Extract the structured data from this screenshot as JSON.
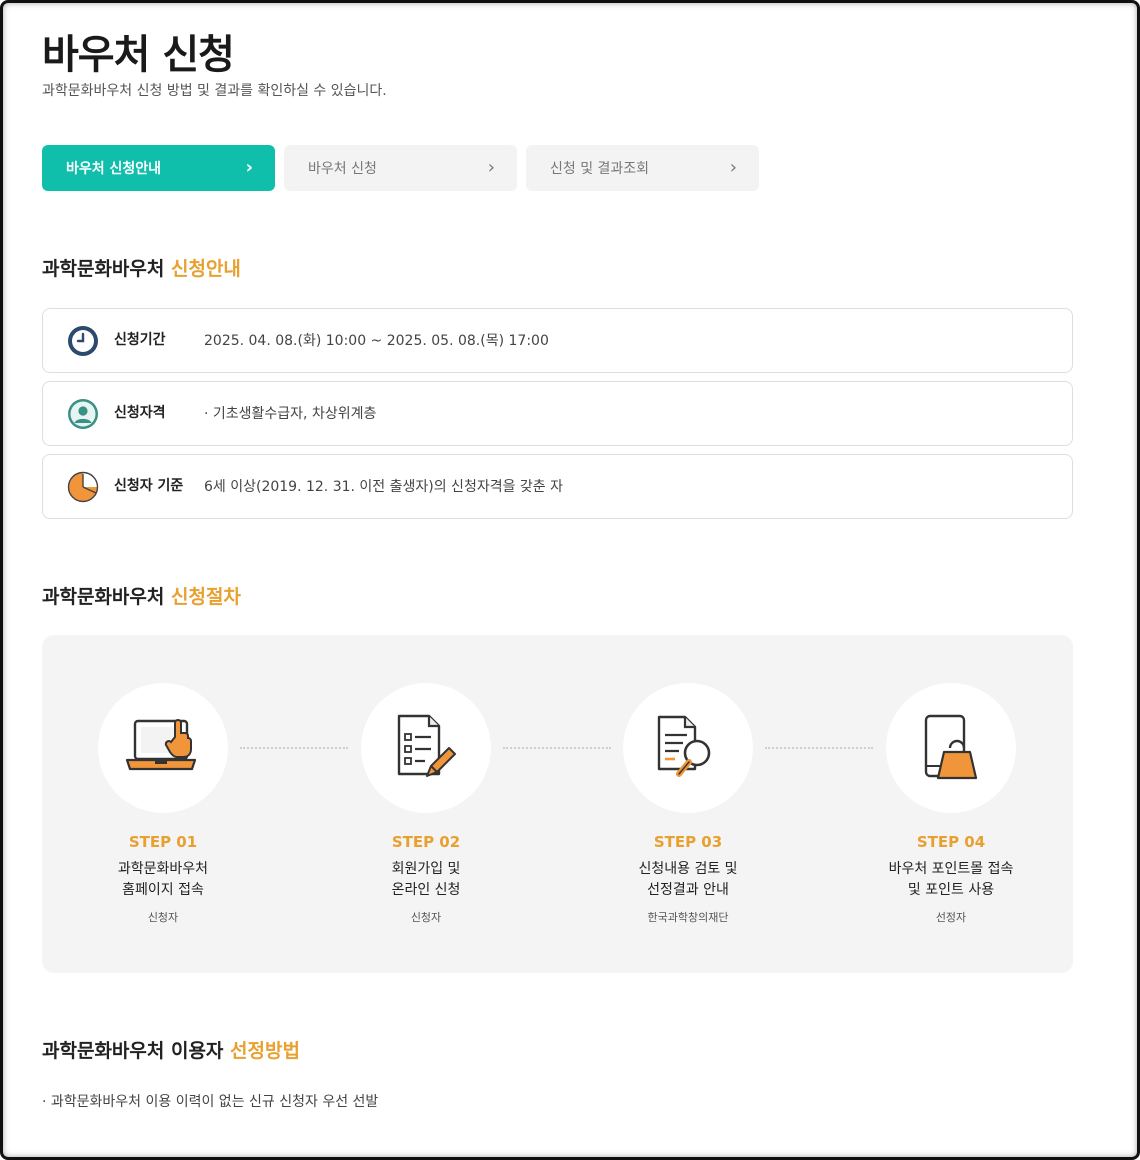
{
  "page": {
    "title": "바우처 신청",
    "description": "과학문화바우처 신청 방법 및 결과를 확인하실 수 있습니다."
  },
  "tabs": [
    {
      "label": "바우처 신청안내",
      "active": true
    },
    {
      "label": "바우처 신청",
      "active": false
    },
    {
      "label": "신청 및 결과조회",
      "active": false
    }
  ],
  "section_guide": {
    "title_main": "과학문화바우처 ",
    "title_highlight": "신청안내"
  },
  "info_rows": [
    {
      "icon": "clock-icon",
      "label": "신청기간",
      "value": "2025. 04. 08.(화) 10:00 ~ 2025. 05. 08.(목) 17:00"
    },
    {
      "icon": "user-icon",
      "label": "신청자격",
      "value": "· 기초생활수급자, 차상위계층"
    },
    {
      "icon": "pie-chart-icon",
      "label": "신청자 기준",
      "value": "6세 이상(2019. 12. 31. 이전 출생자)의 신청자격을 갖춘 자"
    }
  ],
  "section_procedure": {
    "title_main": "과학문화바우처 ",
    "title_highlight": "신청절차"
  },
  "steps": [
    {
      "icon": "laptop-touch-icon",
      "num": "STEP 01",
      "line1": "과학문화바우처",
      "line2": "홈페이지 접속",
      "who": "신청자"
    },
    {
      "icon": "document-pencil-icon",
      "num": "STEP 02",
      "line1": "회원가입 및",
      "line2": "온라인 신청",
      "who": "신청자"
    },
    {
      "icon": "document-search-icon",
      "num": "STEP 03",
      "line1": "신청내용 검토 및",
      "line2": "선정결과 안내",
      "who": "한국과학창의재단"
    },
    {
      "icon": "mobile-shopping-icon",
      "num": "STEP 04",
      "line1": "바우처 포인트몰 접속",
      "line2": "및 포인트 사용",
      "who": "선정자"
    }
  ],
  "section_selection": {
    "title_main": "과학문화바우처 이용자 ",
    "title_highlight": "선정방법"
  },
  "selection_text": "· 과학문화바우처 이용 이력이 없는 신규 신청자 우선 선발",
  "colors": {
    "accent": "#10bfab",
    "highlight": "#e8a030",
    "navy": "#2b4a6e"
  }
}
